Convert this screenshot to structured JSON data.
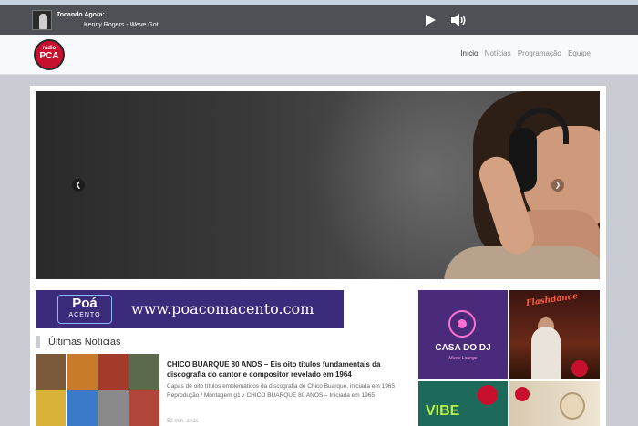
{
  "player": {
    "now_playing_label": "Tocando Agora:",
    "track": "Kenny Rogers - Weve Got"
  },
  "logo": {
    "line1": "rádio",
    "line2": "PCA"
  },
  "nav": {
    "items": [
      "Início",
      "Notícias",
      "Programação",
      "Equipe"
    ],
    "active": "Início"
  },
  "carousel": {
    "prev_icon": "chevron-left-icon",
    "next_icon": "chevron-right-icon"
  },
  "banner": {
    "logo_top": "Poá",
    "logo_bottom": "ACENTO",
    "url": "www.poacomacento.com"
  },
  "news_section": {
    "title": "Últimas Notícias",
    "items": [
      {
        "title": "CHICO BUARQUE 80 ANOS – Eis oito títulos fundamentais da discografia do cantor e compositor revelado em 1964",
        "description": "Capas de oito títulos emblemáticos da discografia de Chico Buarque, iniciada em 1965 Reprodução / Montagem g1 ♪ CHICO BUARQUE 80 ANOS – Iniciada em 1965",
        "time": "52 min. atrás"
      }
    ]
  },
  "tiles": {
    "dj_name": "CASA DO DJ",
    "dj_sub": "Music Lounge",
    "flash_brand": "Flashdance",
    "vibe_text": "VIBE"
  },
  "colors": {
    "player_bg": "#4d5156",
    "accent_red": "#c8102e",
    "banner_purple": "#3c2a7a"
  }
}
